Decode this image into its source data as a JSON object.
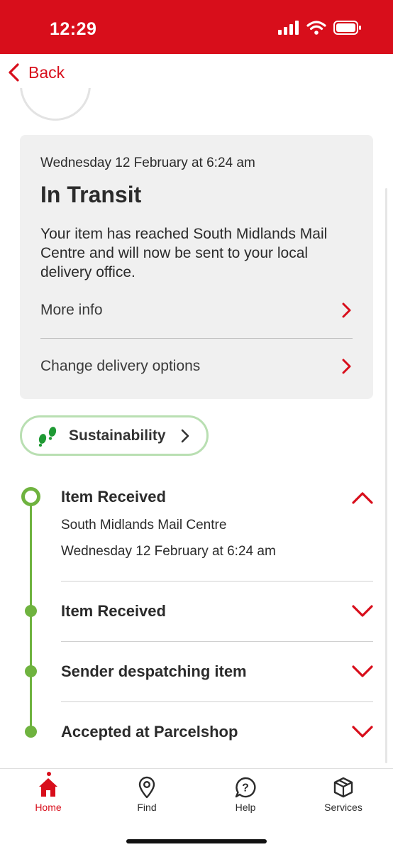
{
  "status_bar": {
    "time": "12:29"
  },
  "nav": {
    "back_label": "Back"
  },
  "summary_card": {
    "date": "Wednesday 12 February at 6:24 am",
    "status_title": "In Transit",
    "description": "Your item has reached South Midlands Mail Centre and will now be sent to your local delivery office.",
    "more_info_label": "More info",
    "change_delivery_label": "Change delivery options"
  },
  "sustainability": {
    "label": "Sustainability"
  },
  "timeline": {
    "events": [
      {
        "title": "Item Received",
        "location": "South Midlands Mail Centre",
        "date": "Wednesday 12 February at 6:24 am",
        "expanded": true
      },
      {
        "title": "Item Received",
        "expanded": false
      },
      {
        "title": "Sender despatching item",
        "expanded": false
      },
      {
        "title": "Accepted at Parcelshop",
        "expanded": false
      }
    ]
  },
  "tab_bar": {
    "tabs": [
      {
        "label": "Home",
        "icon": "home-icon",
        "active": true
      },
      {
        "label": "Find",
        "icon": "location-pin-icon",
        "active": false
      },
      {
        "label": "Help",
        "icon": "help-icon",
        "active": false
      },
      {
        "label": "Services",
        "icon": "package-icon",
        "active": false
      }
    ]
  },
  "colors": {
    "brand_red": "#d80e1b",
    "timeline_green": "#6fb33f",
    "card_gray": "#f0f0f0"
  }
}
